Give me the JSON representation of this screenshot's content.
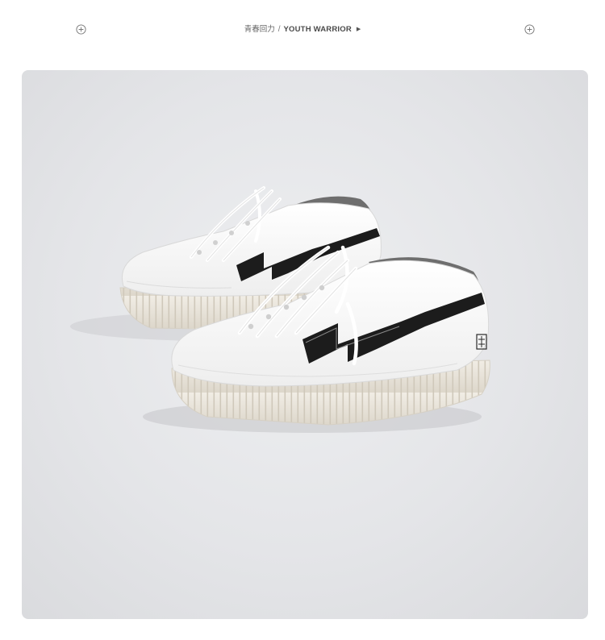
{
  "header": {
    "brand_cn": "青春回力",
    "separator": "/",
    "brand_en": "YOUTH WARRIOR",
    "arrow_icon": "play-arrow-icon",
    "left_icon": "plus-circle-icon",
    "right_icon": "plus-circle-icon"
  },
  "photo": {
    "subject": "white-sneakers-pair",
    "accent_color": "#1c1c1c",
    "lining_color": "#6e6e6e",
    "sole_color": "#ebe6dc",
    "background_color": "#e6e7ea"
  }
}
